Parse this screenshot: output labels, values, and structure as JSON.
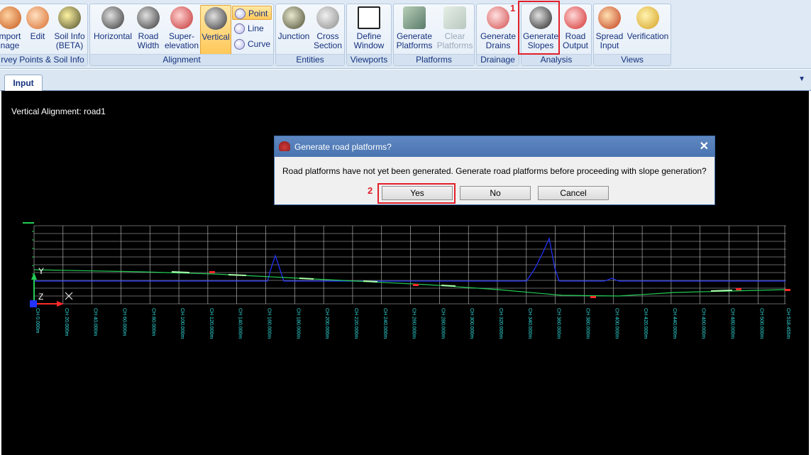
{
  "ribbon": {
    "groups": {
      "survey": {
        "label": "rvey Points & Soil Info",
        "buttons": [
          "mport\nnage",
          "Edit",
          "Soil Info\n(BETA)"
        ]
      },
      "alignment": {
        "label": "Alignment",
        "buttons": [
          "Horizontal",
          "Road\nWidth",
          "Super-\nelevation",
          "Vertical"
        ],
        "small_buttons": [
          "Point",
          "Line",
          "Curve"
        ]
      },
      "entities": {
        "label": "Entities",
        "buttons": [
          "Junction",
          "Cross\nSection"
        ]
      },
      "viewports": {
        "label": "Viewports",
        "buttons": [
          "Define\nWindow"
        ]
      },
      "platforms": {
        "label": "Platforms",
        "buttons": [
          "Generate\nPlatforms",
          "Clear\nPlatforms"
        ]
      },
      "drainage": {
        "label": "Drainage",
        "buttons": [
          "Generate\nDrains"
        ]
      },
      "analysis": {
        "label": "Analysis",
        "buttons": [
          "Generate\nSlopes",
          "Road\nOutput"
        ]
      },
      "views": {
        "label": "Views",
        "buttons": [
          "Spread\nInput",
          "Verification"
        ]
      }
    },
    "step_markers": [
      "1",
      "2"
    ]
  },
  "tabs": {
    "input": "Input",
    "dropdown": "▼"
  },
  "canvas": {
    "title": "Vertical Alignment: road1",
    "axis_labels": {
      "y": "Y",
      "z": "Z",
      "x": "X"
    },
    "chainages": [
      "CH 0.000m",
      "CH 20.000m",
      "CH 40.000m",
      "CH 60.000m",
      "CH 80.000m",
      "CH 100.000m",
      "CH 120.000m",
      "CH 140.000m",
      "CH 160.000m",
      "CH 180.000m",
      "CH 200.000m",
      "CH 220.000m",
      "CH 240.000m",
      "CH 260.000m",
      "CH 280.000m",
      "CH 300.000m",
      "CH 320.000m",
      "CH 340.000m",
      "CH 360.000m",
      "CH 380.000m",
      "CH 400.000m",
      "CH 420.000m",
      "CH 440.000m",
      "CH 460.000m",
      "CH 480.000m",
      "CH 500.000m",
      "CH 518.455m"
    ],
    "colors": {
      "grid": "#c8c8c8",
      "ground": "#2233ff",
      "design": "#22cc55",
      "labels": "#33e0e0"
    }
  },
  "dialog": {
    "title": "Generate road platforms?",
    "close": "✕",
    "message": "Road platforms have not yet been generated. Generate road platforms before proceeding with slope generation?",
    "yes": "Yes",
    "no": "No",
    "cancel": "Cancel"
  }
}
